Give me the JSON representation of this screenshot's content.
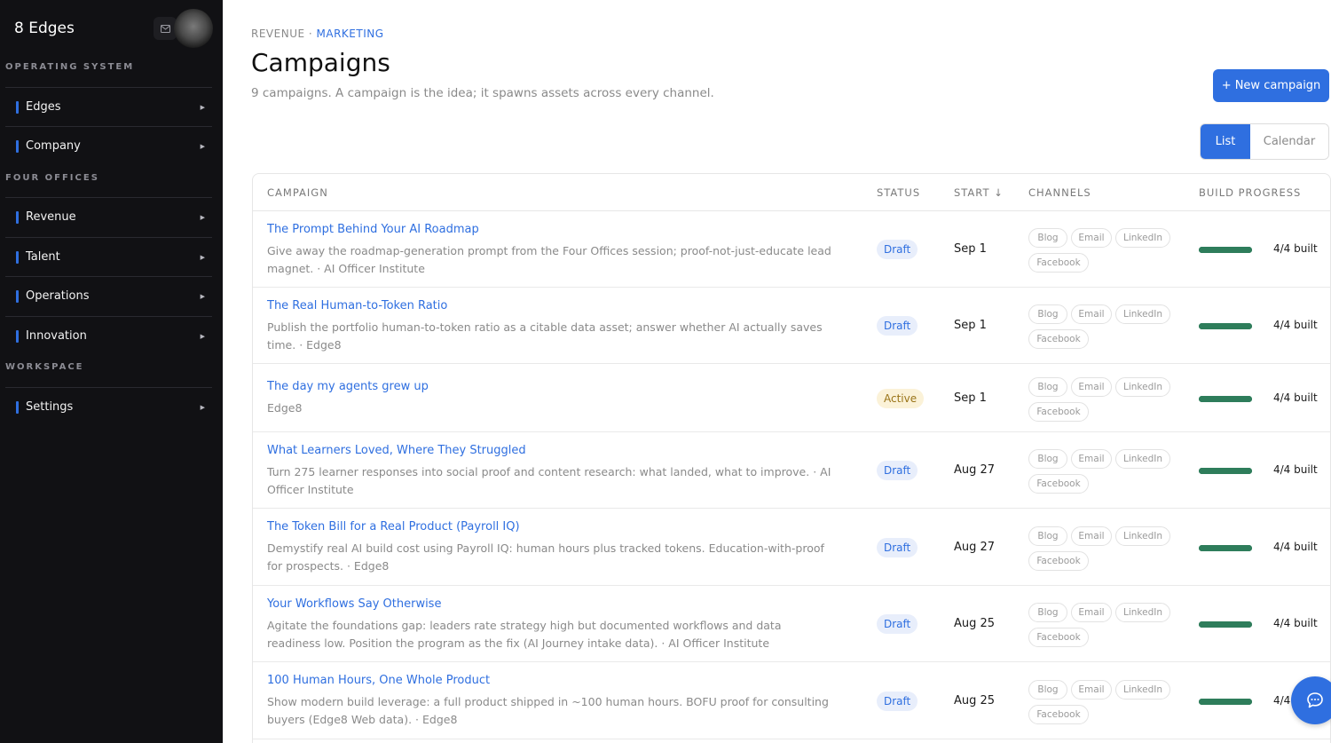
{
  "sidebar": {
    "brand": "8 Edges",
    "brand_icon": "mail-icon",
    "sections": [
      {
        "label": "OPERATING SYSTEM",
        "items": [
          "Edges",
          "Company"
        ]
      },
      {
        "label": "FOUR OFFICES",
        "items": [
          "Revenue",
          "Talent",
          "Operations",
          "Innovation"
        ]
      },
      {
        "label": "WORKSPACE",
        "items": [
          "Settings"
        ]
      }
    ]
  },
  "header": {
    "breadcrumb_root": "REVENUE",
    "breadcrumb_sep": " · ",
    "breadcrumb_active": "MARKETING",
    "title": "Campaigns",
    "subtitle": "9 campaigns. A campaign is the idea; it spawns assets across every channel.",
    "new_button": "+ New campaign",
    "view_list": "List",
    "view_calendar": "Calendar"
  },
  "table": {
    "columns": {
      "campaign": "CAMPAIGN",
      "status": "STATUS",
      "start": "START ↓",
      "channels": "CHANNELS",
      "progress": "BUILD PROGRESS"
    },
    "rows": [
      {
        "title": "The Prompt Behind Your AI Roadmap",
        "desc": "Give away the roadmap-generation prompt from the Four Offices session; proof-not-just-educate lead magnet. · AI Officer Institute",
        "status": "Draft",
        "start": "Sep 1",
        "channels": [
          "Blog",
          "Email",
          "LinkedIn",
          "Facebook"
        ],
        "progress": 1.0,
        "built": "4/4 built"
      },
      {
        "title": "The Real Human-to-Token Ratio",
        "desc": "Publish the portfolio human-to-token ratio as a citable data asset; answer whether AI actually saves time. · Edge8",
        "status": "Draft",
        "start": "Sep 1",
        "channels": [
          "Blog",
          "Email",
          "LinkedIn",
          "Facebook"
        ],
        "progress": 1.0,
        "built": "4/4 built"
      },
      {
        "title": "The day my agents grew up",
        "desc": "Edge8",
        "status": "Active",
        "start": "Sep 1",
        "channels": [
          "Blog",
          "Email",
          "LinkedIn",
          "Facebook"
        ],
        "progress": 1.0,
        "built": "4/4 built"
      },
      {
        "title": "What Learners Loved, Where They Struggled",
        "desc": "Turn 275 learner responses into social proof and content research: what landed, what to improve. · AI Officer Institute",
        "status": "Draft",
        "start": "Aug 27",
        "channels": [
          "Blog",
          "Email",
          "LinkedIn",
          "Facebook"
        ],
        "progress": 1.0,
        "built": "4/4 built"
      },
      {
        "title": "The Token Bill for a Real Product (Payroll IQ)",
        "desc": "Demystify real AI build cost using Payroll IQ: human hours plus tracked tokens. Education-with-proof for prospects. · Edge8",
        "status": "Draft",
        "start": "Aug 27",
        "channels": [
          "Blog",
          "Email",
          "LinkedIn",
          "Facebook"
        ],
        "progress": 1.0,
        "built": "4/4 built"
      },
      {
        "title": "Your Workflows Say Otherwise",
        "desc": "Agitate the foundations gap: leaders rate strategy high but documented workflows and data readiness low. Position the program as the fix (AI Journey intake data). · AI Officer Institute",
        "status": "Draft",
        "start": "Aug 25",
        "channels": [
          "Blog",
          "Email",
          "LinkedIn",
          "Facebook"
        ],
        "progress": 1.0,
        "built": "4/4 built"
      },
      {
        "title": "100 Human Hours, One Whole Product",
        "desc": "Show modern build leverage: a full product shipped in ~100 human hours. BOFU proof for consulting buyers (Edge8 Web data). · Edge8",
        "status": "Draft",
        "start": "Aug 25",
        "channels": [
          "Blog",
          "Email",
          "LinkedIn",
          "Facebook"
        ],
        "progress": 1.0,
        "built": "4/4"
      }
    ]
  },
  "chat": {
    "icon": "chat-icon"
  },
  "colors": {
    "accent": "#2f6fe0",
    "progress": "#2e7d5b",
    "sidebar": "#111114"
  }
}
